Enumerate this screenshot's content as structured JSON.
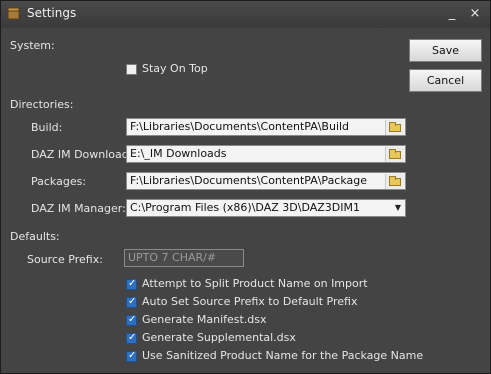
{
  "window": {
    "title": "Settings",
    "minimize_glyph": "_",
    "close_glyph": "×",
    "icon": "package-icon"
  },
  "system": {
    "heading": "System:",
    "stay_on_top": {
      "label": "Stay On Top",
      "checked": false
    }
  },
  "directories": {
    "heading": "Directories:",
    "build": {
      "label": "Build:",
      "value": "F:\\Libraries\\Documents\\ContentPA\\Build"
    },
    "daz_im_download": {
      "label": "DAZ IM Download:",
      "value": "E:\\_IM Downloads"
    },
    "packages": {
      "label": "Packages:",
      "value": "F:\\Libraries\\Documents\\ContentPA\\Package"
    },
    "daz_im_manager": {
      "label": "DAZ IM Manager:",
      "value": "C:\\Program Files (x86)\\DAZ 3D\\DAZ3DIM1"
    }
  },
  "defaults": {
    "heading": "Defaults:",
    "source_prefix": {
      "label": "Source Prefix:",
      "placeholder": "UPTO 7 CHAR/#",
      "value": ""
    },
    "options": [
      {
        "label": "Attempt to Split Product Name on Import",
        "checked": true
      },
      {
        "label": "Auto Set Source Prefix to Default Prefix",
        "checked": true
      },
      {
        "label": "Generate Manifest.dsx",
        "checked": true
      },
      {
        "label": "Generate Supplemental.dsx",
        "checked": true
      },
      {
        "label": "Use Sanitized Product Name for the Package Name",
        "checked": true
      }
    ]
  },
  "buttons": {
    "save": "Save",
    "cancel": "Cancel"
  },
  "colors": {
    "window_bg": "#444444",
    "checkbox_on": "#2f6fbf",
    "folder": "#e8c75a"
  }
}
